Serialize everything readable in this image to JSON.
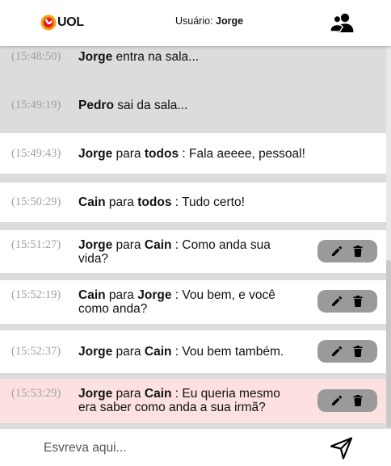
{
  "header": {
    "logo_text": "UOL",
    "user_prefix": "Usuário:",
    "user_name": "Jorge"
  },
  "messages": [
    {
      "time": "(15:48:50)",
      "from": "Jorge",
      "text": "entra na sala..."
    },
    {
      "time": "(15:49:19)",
      "from": "Pedro",
      "text": "sai da sala..."
    },
    {
      "time": "(15:49:43)",
      "from": "Jorge",
      "connector": "para",
      "to": "todos",
      "text": ": Fala aeeee, pessoal!"
    },
    {
      "time": "(15:50:29)",
      "from": "Cain",
      "connector": "para",
      "to": "todos",
      "text": ": Tudo certo!"
    },
    {
      "time": "(15:51:27)",
      "from": "Jorge",
      "connector": "para",
      "to": "Cain",
      "text": ": Como anda sua vida?"
    },
    {
      "time": "(15:52:19)",
      "from": "Cain",
      "connector": "para",
      "to": "Jorge",
      "text": ": Vou bem, e você como anda?"
    },
    {
      "time": "(15:52:37)",
      "from": "Jorge",
      "connector": "para",
      "to": "Cain",
      "text": ": Vou bem também."
    },
    {
      "time": "(15:53:29)",
      "from": "Jorge",
      "connector": "para",
      "to": "Cain",
      "text": ": Eu queria mesmo era saber como anda a sua irmã?"
    }
  ],
  "footer": {
    "input_placeholder": "Esvreva aqui...",
    "input_value": ""
  },
  "colors": {
    "status_bg": "#dcdcdc",
    "public_bg": "#ffffff",
    "highlight_bg": "#fde0e0",
    "action_bg": "#9a9a9a",
    "logo_orange": "#f5a00f",
    "logo_red": "#e31b23"
  },
  "icons": {
    "people": "people-icon",
    "edit": "pencil-icon",
    "delete": "trash-icon",
    "send": "send-icon"
  }
}
